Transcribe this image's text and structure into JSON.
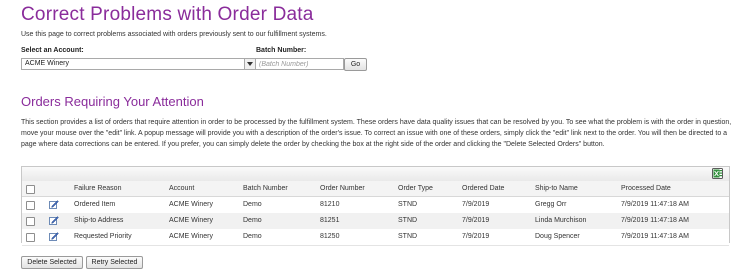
{
  "page": {
    "title": "Correct Problems with Order Data",
    "intro": "Use this page to correct problems associated with orders previously sent to our fulfillment systems."
  },
  "filters": {
    "account_label": "Select an Account:",
    "account_value": "ACME Winery",
    "batch_label": "Batch Number:",
    "batch_placeholder": "(Batch Number)",
    "go_label": "Go"
  },
  "section": {
    "title": "Orders Requiring Your Attention",
    "description": "This section provides a list of orders that require attention in order to be processed by the fulfillment system. These orders have data quality issues that can be resolved by you. To see what the problem is with the order in question, move your mouse over the \"edit\" link. A popup message will provide you with a description of the order's issue. To correct an issue with one of these orders, simply click the \"edit\" link next to the order. You will then be directed to a page where data corrections can be entered. If you prefer, you can simply delete the order by checking the box at the right side of the order and clicking the \"Delete Selected Orders\" button."
  },
  "grid": {
    "columns": [
      "Failure Reason",
      "Account",
      "Batch Number",
      "Order Number",
      "Order Type",
      "Ordered Date",
      "Ship-to Name",
      "Processed Date"
    ],
    "rows": [
      [
        "Ordered Item",
        "ACME Winery",
        "Demo",
        "81210",
        "STND",
        "7/9/2019",
        "Gregg Orr",
        "7/9/2019 11:47:18 AM"
      ],
      [
        "Ship-to Address",
        "ACME Winery",
        "Demo",
        "81251",
        "STND",
        "7/9/2019",
        "Linda Murchison",
        "7/9/2019 11:47:18 AM"
      ],
      [
        "Requested Priority",
        "ACME Winery",
        "Demo",
        "81250",
        "STND",
        "7/9/2019",
        "Doug Spencer",
        "7/9/2019 11:47:18 AM"
      ]
    ]
  },
  "actions": {
    "delete_label": "Delete Selected",
    "retry_label": "Retry Selected"
  },
  "icons": {
    "export": "excel-export-icon",
    "edit": "edit-pencil-icon"
  },
  "colors": {
    "heading": "#8a2c9b",
    "row_alt": "#f1f1f1"
  }
}
